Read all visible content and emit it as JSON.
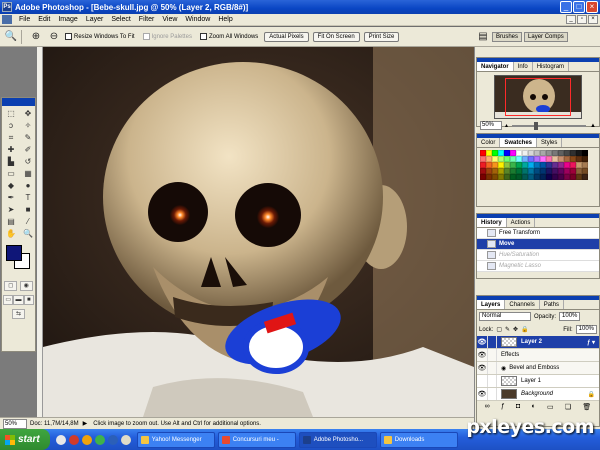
{
  "app": {
    "title": "Adobe Photoshop - [Bebe-skull.jpg @ 50% (Layer 2, RGB/8#)]",
    "logo": "Ps"
  },
  "window_controls": [
    "minimize-icon",
    "maximize-icon",
    "close-icon"
  ],
  "menu": [
    "File",
    "Edit",
    "Image",
    "Layer",
    "Select",
    "Filter",
    "View",
    "Window",
    "Help"
  ],
  "options": {
    "resize_windows": "Resize Windows To Fit",
    "ignore_palettes": "Ignore Palettes",
    "zoom_all": "Zoom All Windows",
    "actual_pixels": "Actual Pixels",
    "fit_on_screen": "Fit On Screen",
    "print_size": "Print Size"
  },
  "palette_well": {
    "brushes": "Brushes",
    "layer_comps": "Layer Comps"
  },
  "status": {
    "zoom": "50%",
    "doc": "Doc: 11,7M/14,8M",
    "hint": "Click image to zoom out. Use Alt and Ctrl for additional options."
  },
  "navigator": {
    "tabs": [
      "Navigator",
      "Info",
      "Histogram"
    ],
    "zoom": "50%"
  },
  "swatches": {
    "tabs": [
      "Color",
      "Swatches",
      "Styles"
    ],
    "colors": [
      "#ff0000",
      "#ffff00",
      "#00ff00",
      "#00ffff",
      "#0000ff",
      "#ff00ff",
      "#ffffff",
      "#f0f0f0",
      "#d8d8d8",
      "#c0c0c0",
      "#a8a8a8",
      "#909090",
      "#787878",
      "#606060",
      "#484848",
      "#303030",
      "#181818",
      "#000000",
      "#ff6f6f",
      "#ffb06f",
      "#ffff6f",
      "#b0ff6f",
      "#6fff6f",
      "#6fffb0",
      "#6fffff",
      "#6fb0ff",
      "#6f6fff",
      "#b06fff",
      "#ff6fff",
      "#ff6fb0",
      "#e8c0a0",
      "#c89070",
      "#a86840",
      "#884818",
      "#603010",
      "#402008",
      "#ed1c24",
      "#f26522",
      "#f7941d",
      "#fff200",
      "#8dc63f",
      "#39b54a",
      "#00a651",
      "#00a99d",
      "#00aeef",
      "#0072bc",
      "#0054a6",
      "#2e3192",
      "#662d91",
      "#92278f",
      "#ec008c",
      "#ed145b",
      "#c69c6d",
      "#a67c52",
      "#9e0b0f",
      "#a0410d",
      "#a36209",
      "#aba000",
      "#598527",
      "#1a7b30",
      "#007236",
      "#00746b",
      "#0076a3",
      "#004a80",
      "#003471",
      "#1b1464",
      "#440e62",
      "#630460",
      "#9e005d",
      "#9e0039",
      "#8c6239",
      "#754c24",
      "#790000",
      "#7b2e00",
      "#7d4900",
      "#827b00",
      "#406618",
      "#005e20",
      "#005826",
      "#005952",
      "#005b7f",
      "#003663",
      "#002157",
      "#0d004c",
      "#32004b",
      "#4b0049",
      "#7b0046",
      "#7a0026",
      "#603913",
      "#3c2415"
    ]
  },
  "history": {
    "tabs": [
      "History",
      "Actions"
    ],
    "items": [
      {
        "label": "Free Transform",
        "state": "normal"
      },
      {
        "label": "Move",
        "state": "active"
      },
      {
        "label": "Hue/Saturation",
        "state": "dim"
      },
      {
        "label": "Magnetic Lasso",
        "state": "dim"
      }
    ]
  },
  "layers": {
    "tabs": [
      "Layers",
      "Channels",
      "Paths"
    ],
    "blend_mode": "Normal",
    "opacity_label": "Opacity:",
    "opacity": "100%",
    "lock_label": "Lock:",
    "fill_label": "Fill:",
    "fill": "100%",
    "rows": [
      {
        "label": "Layer 2",
        "type": "layer",
        "active": true,
        "fx": true
      },
      {
        "label": "Effects",
        "type": "effects",
        "active": false,
        "fx": false
      },
      {
        "label": "Bevel and Emboss",
        "type": "effect",
        "active": false,
        "fx": false
      },
      {
        "label": "Layer 1",
        "type": "layer",
        "active": false,
        "fx": false
      },
      {
        "label": "Background",
        "type": "background",
        "active": false,
        "fx": false
      }
    ]
  },
  "taskbar": {
    "start": "start",
    "tasks": [
      {
        "label": "Yahoo! Messenger",
        "active": false
      },
      {
        "label": "Concursuri meu -",
        "active": false
      },
      {
        "label": "Adobe Photosho...",
        "active": true
      },
      {
        "label": "Downloads",
        "active": false
      }
    ]
  },
  "watermark": "pxleyes.com"
}
